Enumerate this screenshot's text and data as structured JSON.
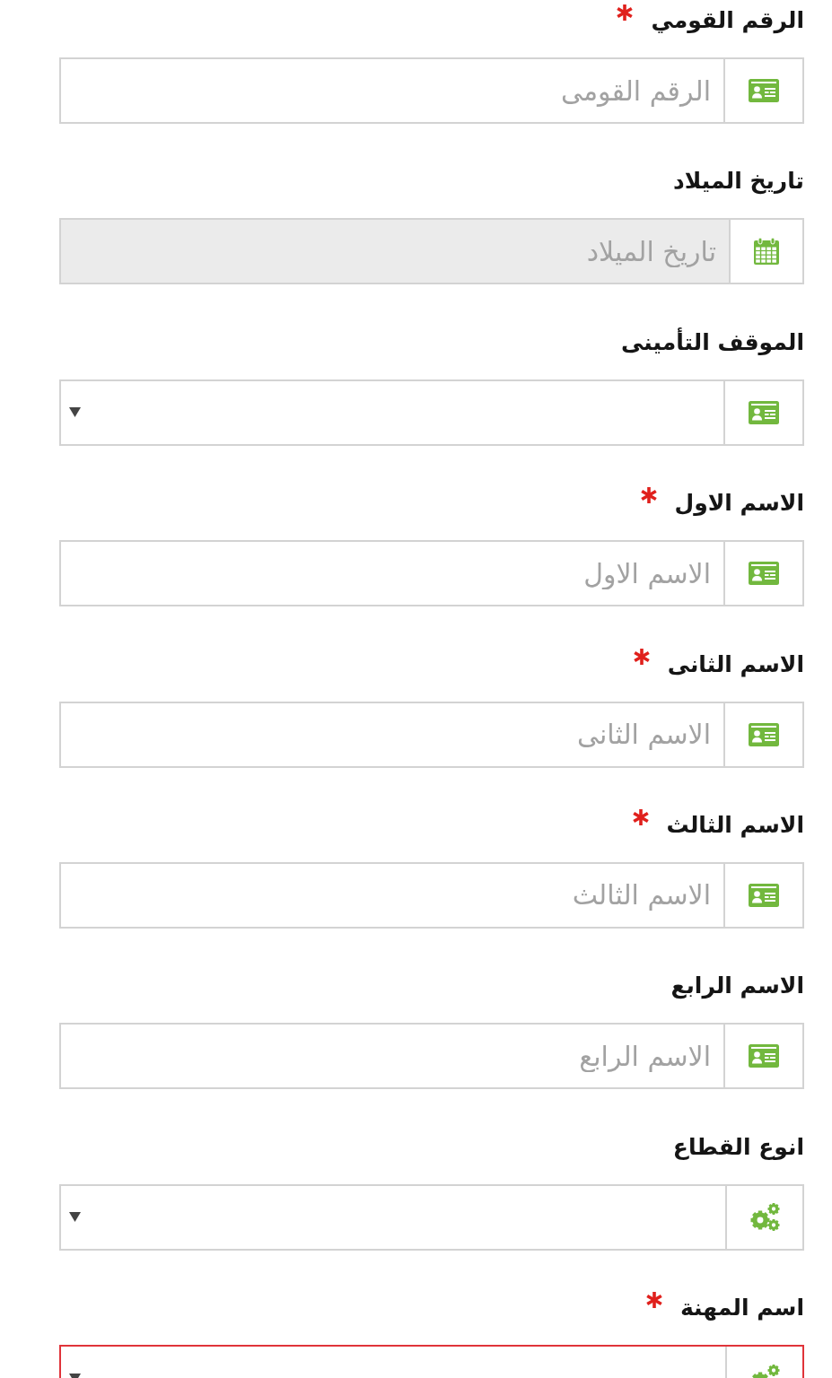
{
  "form": {
    "fields": [
      {
        "kind": "text",
        "label": "الرقم القومي",
        "required": true,
        "disabled": false,
        "invalid": false,
        "placeholder": "الرقم القومى"
      },
      {
        "kind": "date",
        "label": "تاريخ الميلاد",
        "required": false,
        "disabled": true,
        "invalid": false,
        "placeholder": "تاريخ الميلاد"
      },
      {
        "kind": "select",
        "label": "الموقف التأمينى",
        "required": false,
        "disabled": false,
        "invalid": false
      },
      {
        "kind": "text",
        "label": "الاسم الاول",
        "required": true,
        "disabled": false,
        "invalid": false,
        "placeholder": "الاسم الاول"
      },
      {
        "kind": "text",
        "label": "الاسم الثانى",
        "required": true,
        "disabled": false,
        "invalid": false,
        "placeholder": "الاسم الثانى"
      },
      {
        "kind": "text",
        "label": "الاسم الثالث",
        "required": true,
        "disabled": false,
        "invalid": false,
        "placeholder": "الاسم الثالث"
      },
      {
        "kind": "text",
        "label": "الاسم الرابع",
        "required": false,
        "disabled": false,
        "invalid": false,
        "placeholder": "الاسم الرابع"
      },
      {
        "kind": "lookup",
        "label": "انوع القطاع",
        "required": false,
        "disabled": false,
        "invalid": false
      },
      {
        "kind": "lookup",
        "label": "اسم المهنة",
        "required": true,
        "disabled": false,
        "invalid": true
      }
    ]
  }
}
